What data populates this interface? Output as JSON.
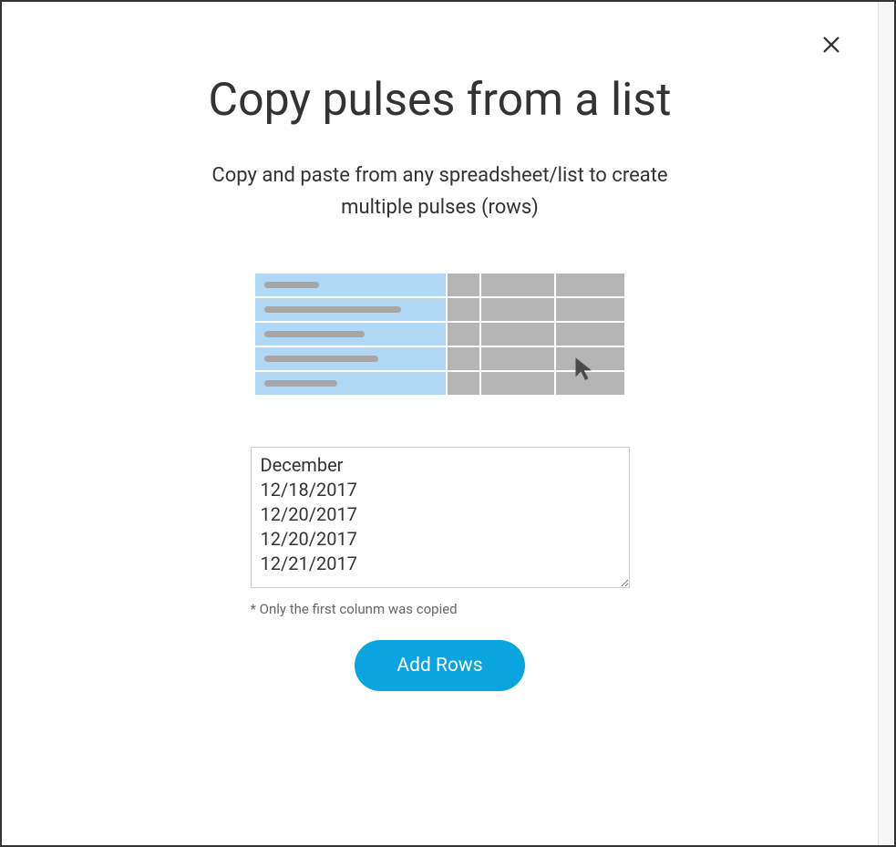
{
  "modal": {
    "title": "Copy pulses from a list",
    "subtitle": "Copy and paste from any spreadsheet/list to create multiple pulses (rows)",
    "textarea_value": "December\n12/18/2017\n12/20/2017\n12/20/2017\n12/21/2017",
    "note": "* Only the first colunm was copied",
    "add_rows_label": "Add Rows"
  },
  "illustration": {
    "row_bar_widths": [
      60,
      150,
      110,
      125,
      80
    ]
  }
}
